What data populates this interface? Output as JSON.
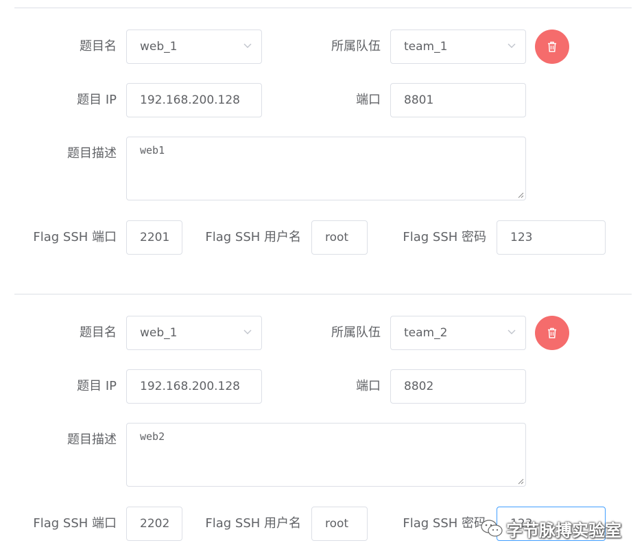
{
  "labels": {
    "title_name": "题目名",
    "team": "所属队伍",
    "ip": "题目 IP",
    "port": "端口",
    "desc": "题目描述",
    "ssh_port": "Flag SSH 端口",
    "ssh_user": "Flag SSH 用户名",
    "ssh_pass": "Flag SSH 密码"
  },
  "entries": [
    {
      "title_name": "web_1",
      "team": "team_1",
      "ip": "192.168.200.128",
      "port": "8801",
      "desc": "web1",
      "ssh_port": "2201",
      "ssh_user": "root",
      "ssh_pass": "123"
    },
    {
      "title_name": "web_1",
      "team": "team_2",
      "ip": "192.168.200.128",
      "port": "8802",
      "desc": "web2",
      "ssh_port": "2202",
      "ssh_user": "root",
      "ssh_pass": "123"
    }
  ],
  "icons": {
    "delete": "trash-icon",
    "dropdown": "chevron-down-icon",
    "resize": "resize-grip-icon"
  },
  "colors": {
    "delete_button": "#f56c6c",
    "focus_border": "#409eff",
    "border": "#dcdfe6",
    "text": "#606266"
  },
  "watermark": {
    "text": "字节脉搏实验室"
  }
}
